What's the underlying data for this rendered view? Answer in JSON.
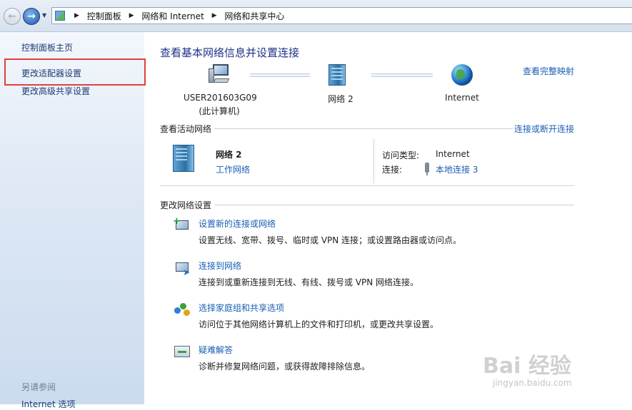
{
  "address_bar": {
    "crumbs": [
      "控制面板",
      "网络和 Internet",
      "网络和共享中心"
    ]
  },
  "sidebar": {
    "home": "控制面板主页",
    "items": [
      "更改适配器设置",
      "更改高级共享设置"
    ],
    "see_also_heading": "另请参阅",
    "see_also": [
      "Internet 选项"
    ]
  },
  "main": {
    "title": "查看基本网络信息并设置连接",
    "view_full_map": "查看完整映射",
    "map": {
      "computer_name": "USER201603G09",
      "computer_note": "(此计算机)",
      "network_name": "网络  2",
      "internet": "Internet"
    },
    "active_networks": {
      "heading": "查看活动网络",
      "connect_disconnect": "连接或断开连接",
      "network_name": "网络  2",
      "network_type": "工作网络",
      "access_type_label": "访问类型:",
      "access_type_value": "Internet",
      "connections_label": "连接:",
      "connections_value": "本地连接 3"
    },
    "change_settings": {
      "heading": "更改网络设置",
      "tasks": [
        {
          "title": "设置新的连接或网络",
          "desc": "设置无线、宽带、拨号、临时或 VPN 连接；或设置路由器或访问点。",
          "icon": "new-connection-icon"
        },
        {
          "title": "连接到网络",
          "desc": "连接到或重新连接到无线、有线、拨号或 VPN 网络连接。",
          "icon": "connect-network-icon"
        },
        {
          "title": "选择家庭组和共享选项",
          "desc": "访问位于其他网络计算机上的文件和打印机，或更改共享设置。",
          "icon": "homegroup-icon"
        },
        {
          "title": "疑难解答",
          "desc": "诊断并修复网络问题，或获得故障排除信息。",
          "icon": "troubleshoot-icon"
        }
      ]
    }
  },
  "watermark": {
    "brand": "Bai 经验",
    "url": "jingyan.baidu.com"
  },
  "colors": {
    "link": "#1a5fb4",
    "title": "#1e3287",
    "highlight_box": "#e0403c"
  }
}
